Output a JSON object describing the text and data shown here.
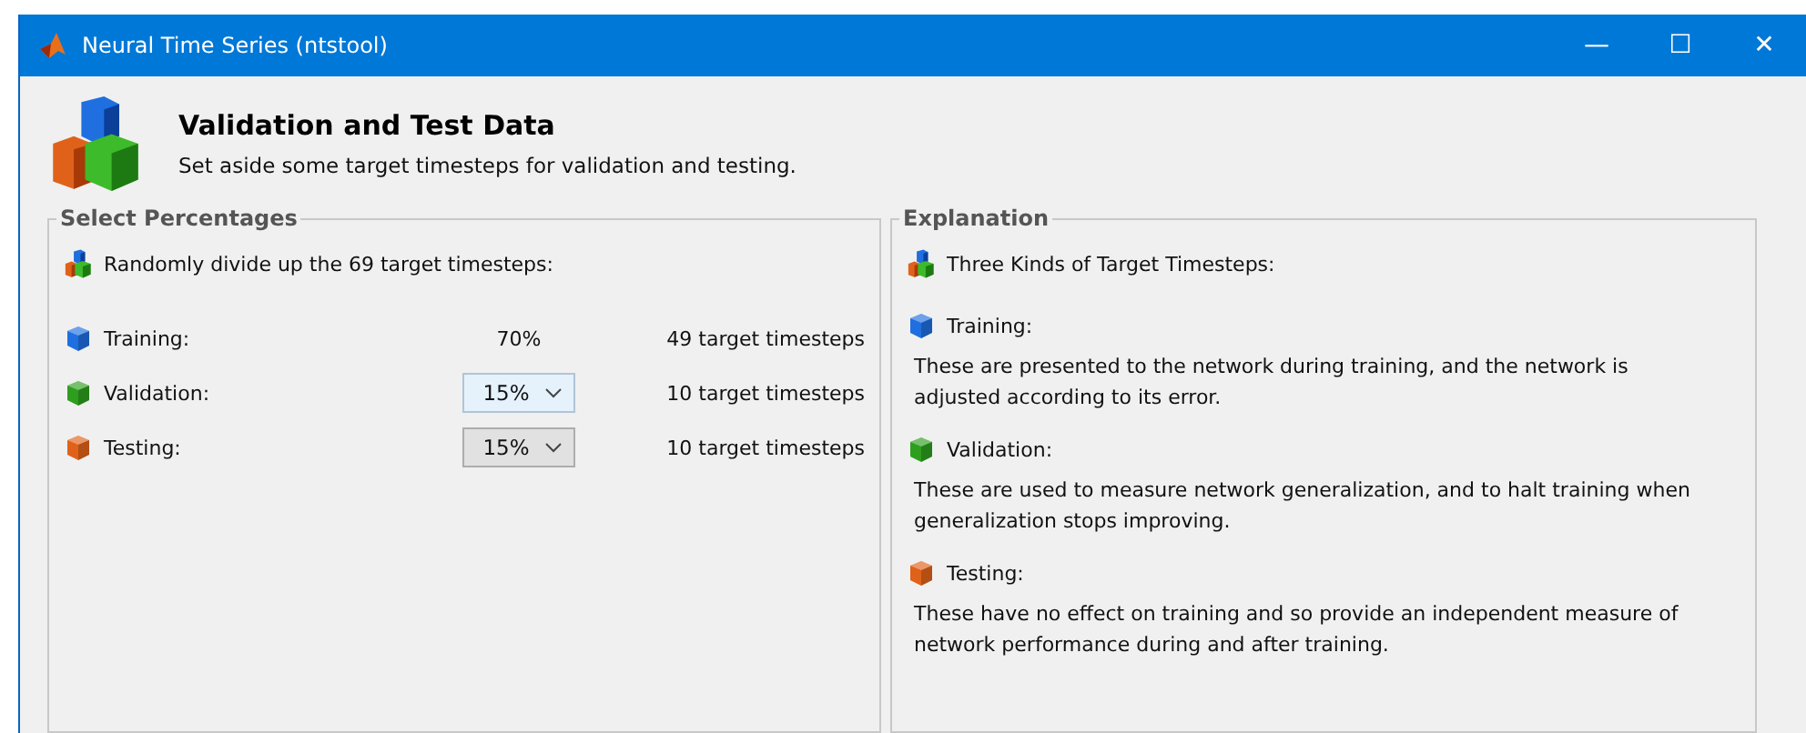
{
  "window": {
    "title": "Neural Time Series (ntstool)",
    "controls": [
      "—",
      "☐",
      "✕"
    ]
  },
  "header": {
    "title": "Validation and Test Data",
    "subtitle": "Set aside some target timesteps for validation and testing."
  },
  "select_percentages": {
    "title": "Select Percentages",
    "intro": "Randomly divide up the 69 target timesteps:",
    "rows": [
      {
        "label": "Training:",
        "color": "#1f6fe0",
        "kind": "text",
        "value": "70%",
        "count": "49 target timesteps"
      },
      {
        "label": "Validation:",
        "color": "#2e9e1e",
        "kind": "dropdown",
        "value": "15%",
        "focused": true,
        "count": "10 target timesteps"
      },
      {
        "label": "Testing:",
        "color": "#e0621a",
        "kind": "dropdown",
        "value": "15%",
        "focused": false,
        "count": "10 target timesteps"
      }
    ]
  },
  "explanation": {
    "title": "Explanation",
    "intro": "Three Kinds of Target Timesteps:",
    "items": [
      {
        "label": "Training:",
        "color": "#1f6fe0",
        "text": "These are presented to the network during training, and the network is adjusted according to its error."
      },
      {
        "label": "Validation:",
        "color": "#2e9e1e",
        "text": "These are used to measure network generalization, and to halt training when generalization stops improving."
      },
      {
        "label": "Testing:",
        "color": "#e0621a",
        "text": "These have no effect on training and so provide an independent measure of network performance during and after training."
      }
    ]
  }
}
